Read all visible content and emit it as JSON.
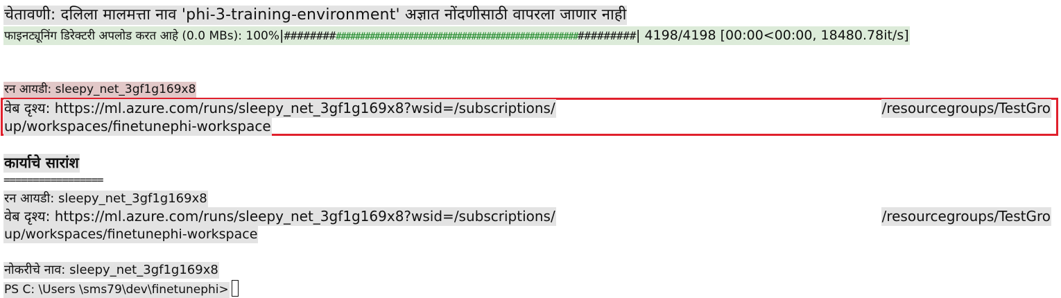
{
  "terminal": {
    "warning": "चेतावणी: दलिला मालमत्ता नाव 'phi-3-training-environment' अज्ञात नोंदणीसाठी वापरला जाणार नाही",
    "upload": {
      "label": "फाइनट्यूनिंग डिरेक्टरी अपलोड करत आहे (0.0 MBs): 100%",
      "bar_open": "|",
      "bar_dark_left": "########",
      "bar_green": "##################################################",
      "bar_dark_right": "#########",
      "bar_close": "|",
      "stats": " 4198/4198 [00:00<00:00, 18480.78it/s]",
      "percent": 100
    },
    "run_id_line_1": "रन आयडी: sleepy_net_3gf1g169x8",
    "web_view_1": {
      "left": "वेब दृश्य: https://ml.azure.com/runs/sleepy_net_3gf1g169x8?wsid=/subscriptions/",
      "right": "/resourcegroups/TestGro",
      "wrap": "up/workspaces/finetunephi-workspace"
    },
    "summary_title": "कार्याचे सारांश",
    "separator": "=================",
    "run_id_line_2": "रन आयडी: sleepy_net_3gf1g169x8",
    "web_view_2": {
      "left": "वेब दृश्य: https://ml.azure.com/runs/sleepy_net_3gf1g169x8?wsid=/subscriptions/",
      "right": "/resourcegroups/TestGro",
      "wrap": "up/workspaces/finetunephi-workspace"
    },
    "job_name": "नोकरीचे नाव: sleepy_net_3gf1g169x8",
    "prompt": "PS C: \\Users \\sms79\\dev\\finetunephi>"
  },
  "colors": {
    "highlight_box": "#e0202c",
    "progress_green": "#1f8a2a",
    "line_highlight": "#e3e3e3"
  }
}
